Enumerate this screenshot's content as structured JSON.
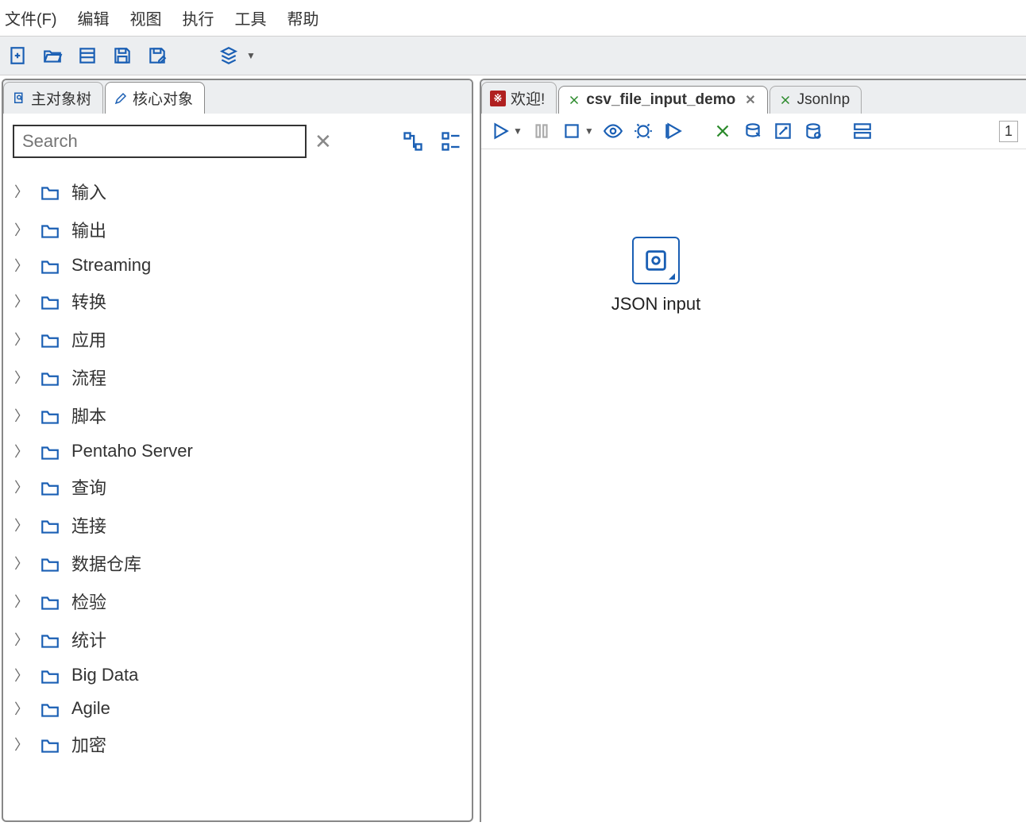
{
  "menu": {
    "items": [
      "文件(F)",
      "编辑",
      "视图",
      "执行",
      "工具",
      "帮助"
    ]
  },
  "left": {
    "tabs": [
      {
        "label": "主对象树"
      },
      {
        "label": "核心对象"
      }
    ],
    "search_placeholder": "Search",
    "tree": [
      "输入",
      "输出",
      "Streaming",
      "转换",
      "应用",
      "流程",
      "脚本",
      "Pentaho Server",
      "查询",
      "连接",
      "数据仓库",
      "检验",
      "统计",
      "Big Data",
      "Agile",
      "加密"
    ]
  },
  "right": {
    "tabs": [
      {
        "label": "欢迎!",
        "icon": "red"
      },
      {
        "label": "csv_file_input_demo",
        "icon": "spoon",
        "active": true,
        "closable": true
      },
      {
        "label": "JsonInp",
        "icon": "spoon"
      }
    ],
    "zoom": "1",
    "node": {
      "label": "JSON input"
    }
  }
}
